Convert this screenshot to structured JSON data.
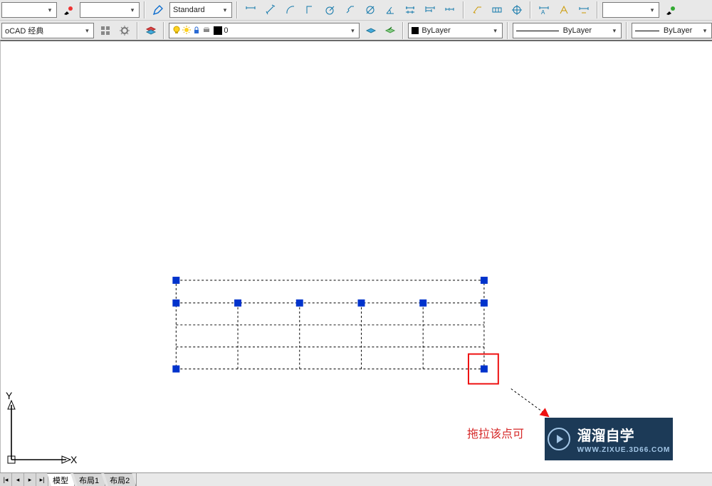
{
  "toolbar1": {
    "textstyle_combo": "Standard",
    "icons": [
      "color-picker",
      "dropdown",
      "brush",
      "dropdown",
      "pencil",
      "linear-dim",
      "aligned-dim",
      "arc-dim",
      "radius-dim",
      "diameter-dim",
      "angular-dim",
      "quick-dim",
      "baseline-dim",
      "continue-dim",
      "quick-leader",
      "tolerance",
      "center-mark",
      "dim-edit",
      "dim-text-edit",
      "dim-update",
      "dim-style",
      "brush2"
    ]
  },
  "toolbar2": {
    "workspace_combo": "oCAD 经典",
    "workspace_icons": [
      "gear-grid-icon",
      "gear-icon"
    ],
    "layer_buttons": [
      "layer-manager-icon"
    ],
    "layer_combo": "0",
    "layer_icons": [
      "layer-isolate-icon",
      "layer-off-icon"
    ],
    "color_combo": "ByLayer",
    "linetype_combo": "ByLayer",
    "lineweight_combo": "ByLayer"
  },
  "canvas": {
    "ucs": {
      "x_label": "X",
      "y_label": "Y"
    },
    "annotation_text": "拖拉该点可",
    "highlight_box": true
  },
  "watermark": {
    "title": "溜溜自学",
    "sub": "WWW.ZIXUE.3D66.COM"
  },
  "tabs": {
    "nav": [
      "first",
      "prev",
      "next",
      "last"
    ],
    "items": [
      "模型",
      "布局1",
      "布局2"
    ],
    "active": "模型"
  }
}
